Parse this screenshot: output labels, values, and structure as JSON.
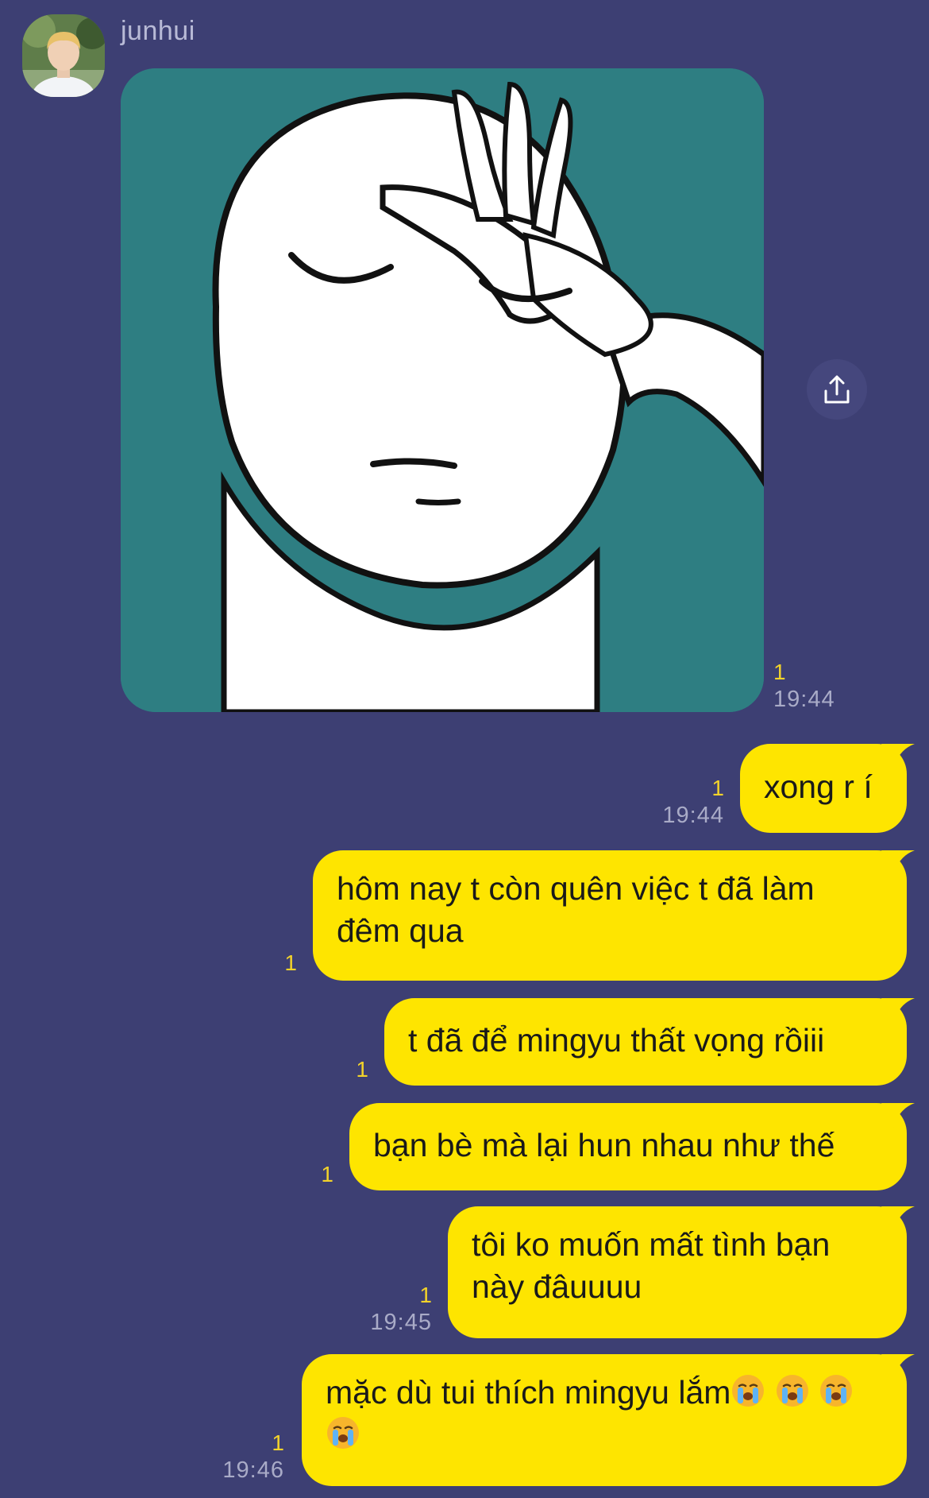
{
  "chat": {
    "sender_name": "junhui",
    "colors": {
      "background": "#3d3f73",
      "bubble": "#fee500",
      "read_count": "#f3d32a",
      "timestamp": "#a9abc7",
      "sender_name": "#b8bad6"
    },
    "incoming_image": {
      "read_count": "1",
      "time": "19:44"
    },
    "share_icon": "share-icon",
    "messages": [
      {
        "text": "xong r í",
        "read_count": "1",
        "time": "19:44"
      },
      {
        "text": "hôm nay t còn quên việc t đã làm đêm qua",
        "read_count": "1",
        "time": ""
      },
      {
        "text": "t đã để mingyu thất vọng rồiii",
        "read_count": "1",
        "time": ""
      },
      {
        "text": "bạn bè mà lại hun nhau như thế",
        "read_count": "1",
        "time": ""
      },
      {
        "text": "tôi ko muốn mất tình bạn này đâuuuu",
        "read_count": "1",
        "time": "19:45"
      },
      {
        "text": "mặc dù tui thích mingyu lắm",
        "emoji": "crying-face-icon",
        "emoji_count": 4,
        "read_count": "1",
        "time": "19:46"
      }
    ]
  }
}
